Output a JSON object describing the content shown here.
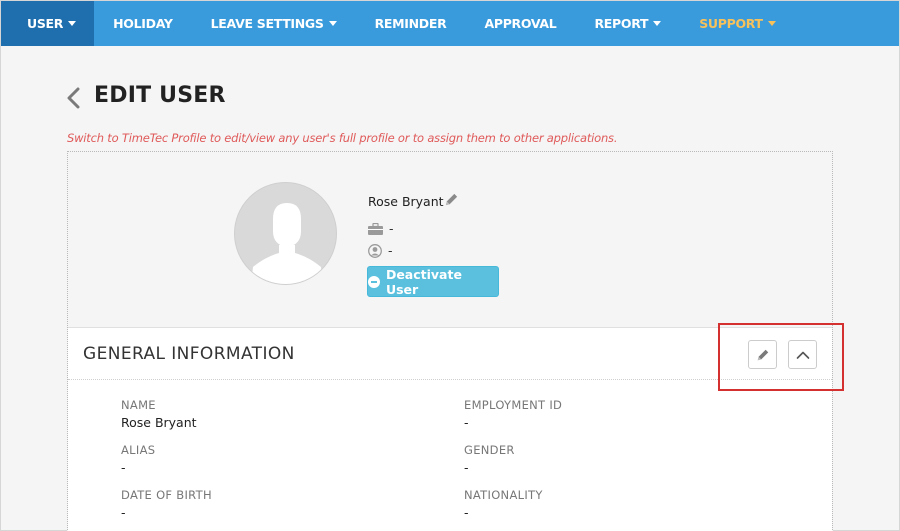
{
  "nav": {
    "items": [
      {
        "label": "USER",
        "caret": true,
        "active": true
      },
      {
        "label": "HOLIDAY",
        "caret": false
      },
      {
        "label": "LEAVE SETTINGS",
        "caret": true
      },
      {
        "label": "REMINDER",
        "caret": false
      },
      {
        "label": "APPROVAL",
        "caret": false
      },
      {
        "label": "REPORT",
        "caret": true
      },
      {
        "label": "SUPPORT",
        "caret": true,
        "highlight_color": "#f7c15b"
      }
    ],
    "bar_color": "#3a9bdc",
    "active_color": "#1f6fae"
  },
  "page": {
    "title": "EDIT USER",
    "notice": "Switch to TimeTec Profile to edit/view any user's full profile or to assign them to other applications."
  },
  "profile": {
    "name": "Rose Bryant",
    "job": "-",
    "role": "-",
    "deactivate_label": "Deactivate User",
    "button_color": "#5bc0de"
  },
  "general_info": {
    "title": "GENERAL INFORMATION",
    "fields": {
      "name": {
        "label": "NAME",
        "value": "Rose Bryant"
      },
      "employment_id": {
        "label": "EMPLOYMENT ID",
        "value": "-"
      },
      "alias": {
        "label": "ALIAS",
        "value": "-"
      },
      "gender": {
        "label": "GENDER",
        "value": "-"
      },
      "dob": {
        "label": "DATE OF BIRTH",
        "value": "-"
      },
      "nationality": {
        "label": "NATIONALITY",
        "value": "-"
      }
    }
  },
  "annotation": {
    "highlight_color": "#d3302f"
  }
}
